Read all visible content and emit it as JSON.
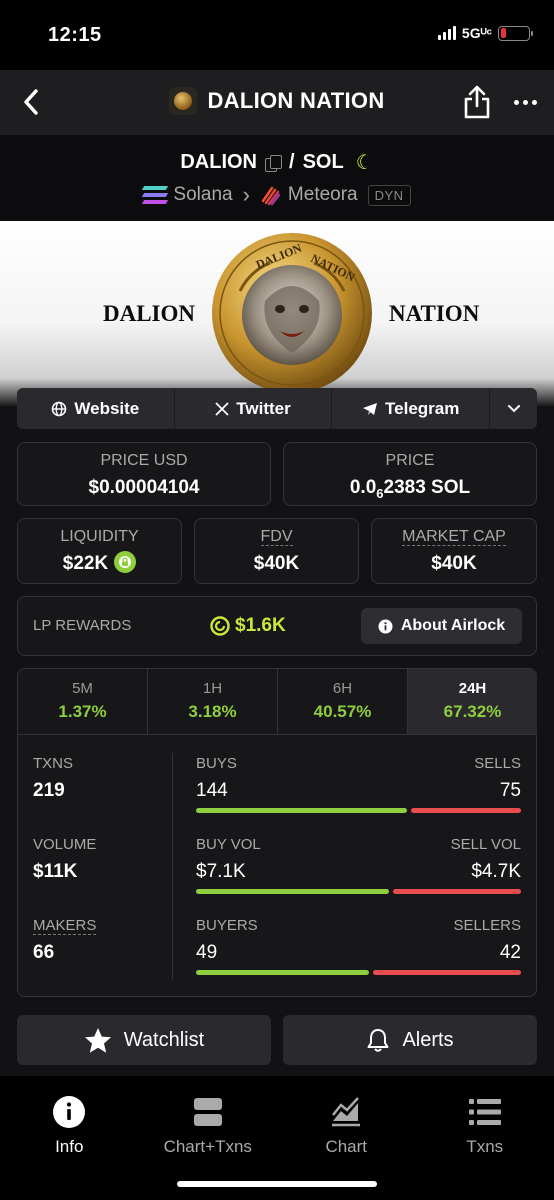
{
  "status_bar": {
    "time": "12:15",
    "network": "5Gᵁᶜ",
    "battery_color": "#e5353b"
  },
  "nav": {
    "title": "DALION NATION"
  },
  "pair": {
    "base": "DALION",
    "separator": "/",
    "quote": "SOL",
    "chain": "Solana",
    "arrow": "›",
    "dex": "Meteora",
    "dex_badge": "DYN"
  },
  "banner": {
    "left_text": "DALION",
    "right_text": "NATION",
    "coin_text_top": "DALION",
    "coin_text_right": "NATION"
  },
  "links": {
    "website": "Website",
    "twitter": "Twitter",
    "telegram": "Telegram"
  },
  "stats": {
    "price_usd_label": "PRICE USD",
    "price_usd": "$0.00004104",
    "price_label": "PRICE",
    "price_prefix": "0.0",
    "price_sub": "6",
    "price_rest": "2383 SOL",
    "liquidity_label": "LIQUIDITY",
    "liquidity": "$22K",
    "fdv_label": "FDV",
    "fdv": "$40K",
    "mcap_label": "MARKET CAP",
    "mcap": "$40K"
  },
  "lp": {
    "label": "LP REWARDS",
    "value": "$1.6K",
    "button": "About Airlock"
  },
  "tabs": [
    {
      "label": "5M",
      "value": "1.37%"
    },
    {
      "label": "1H",
      "value": "3.18%"
    },
    {
      "label": "6H",
      "value": "40.57%"
    },
    {
      "label": "24H",
      "value": "67.32%"
    }
  ],
  "metrics": {
    "txns_label": "TXNS",
    "txns": "219",
    "volume_label": "VOLUME",
    "volume": "$11K",
    "makers_label": "MAKERS",
    "makers": "66",
    "buys_label": "BUYS",
    "buys": "144",
    "sells_label": "SELLS",
    "sells": "75",
    "buys_fraction": 0.658,
    "buyvol_label": "BUY VOL",
    "buyvol": "$7.1K",
    "sellvol_label": "SELL VOL",
    "sellvol": "$4.7K",
    "buyvol_fraction": 0.6,
    "buyers_label": "BUYERS",
    "buyers": "49",
    "sellers_label": "SELLERS",
    "sellers": "42",
    "buyers_fraction": 0.54
  },
  "actions": {
    "watchlist": "Watchlist",
    "alerts": "Alerts"
  },
  "tabbar": [
    {
      "label": "Info",
      "icon": "info-icon"
    },
    {
      "label": "Chart+Txns",
      "icon": "chart-txns-icon"
    },
    {
      "label": "Chart",
      "icon": "chart-icon"
    },
    {
      "label": "Txns",
      "icon": "list-icon"
    }
  ],
  "colors": {
    "green": "#8fce3d",
    "red": "#ea4d4d",
    "lime": "#cbe83a"
  }
}
